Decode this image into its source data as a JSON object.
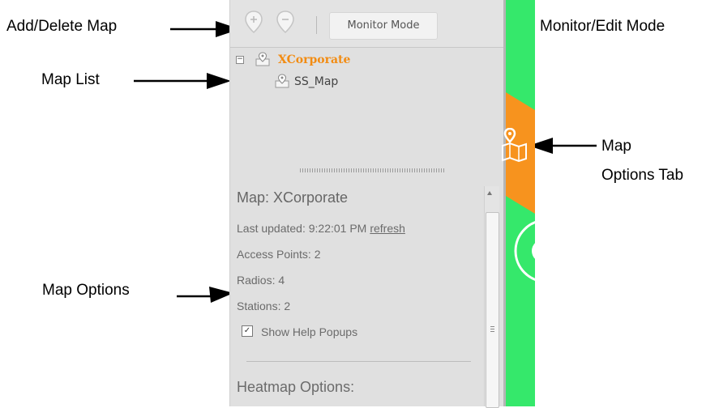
{
  "callouts": {
    "add_delete_map": "Add/Delete Map",
    "monitor_edit_mode": "Monitor/Edit Mode",
    "map_list": "Map List",
    "map_options_tab_line1": "Map",
    "map_options_tab_line2": "Options Tab",
    "map_options": "Map Options"
  },
  "toolbar": {
    "add_icon": "add-map-pin-icon",
    "delete_icon": "delete-map-pin-icon",
    "mode_button_label": "Monitor Mode"
  },
  "map_list": {
    "root": {
      "label": "XCorporate",
      "color": "#f28c13",
      "toggle": "−",
      "icon": "map-pin-icon"
    },
    "children": [
      {
        "label": "SS_Map",
        "icon": "map-pin-icon"
      }
    ]
  },
  "map_options": {
    "title": "Map: XCorporate",
    "last_updated_label": "Last updated: 9:22:01 PM",
    "refresh_link": "refresh",
    "access_points": "Access Points: 2",
    "radios": "Radios: 4",
    "stations": "Stations: 2",
    "show_help_popups": {
      "label": "Show Help Popups",
      "checked": true,
      "mark": "✓"
    },
    "heatmap_title": "Heatmap Options:"
  },
  "colors": {
    "accent_orange": "#f28c13",
    "tab_orange": "#f7931e",
    "panel_bg": "#e0e0e0",
    "edge_green": "#35e86b"
  },
  "icons": {
    "map_options_tab": "map-options-icon"
  }
}
